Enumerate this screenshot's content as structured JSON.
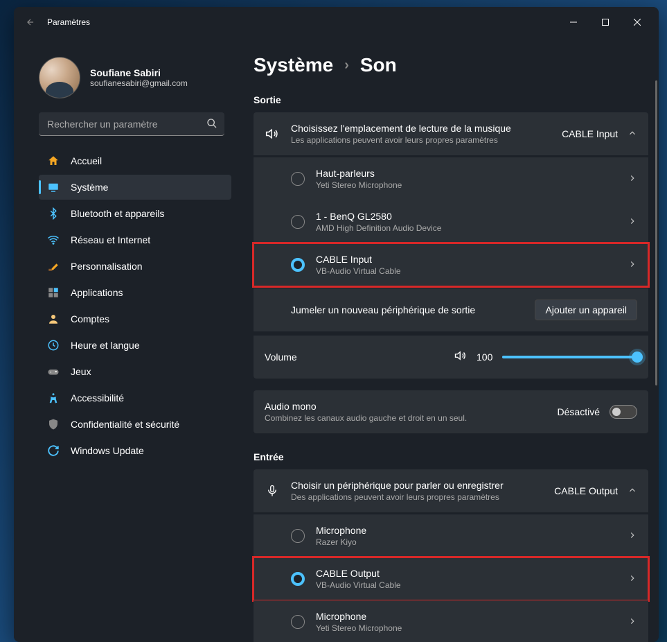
{
  "window": {
    "title": "Paramètres"
  },
  "profile": {
    "name": "Soufiane Sabiri",
    "email": "soufianesabiri@gmail.com"
  },
  "search": {
    "placeholder": "Rechercher un paramètre"
  },
  "nav": [
    {
      "label": "Accueil",
      "icon": "home"
    },
    {
      "label": "Système",
      "icon": "system",
      "active": true
    },
    {
      "label": "Bluetooth et appareils",
      "icon": "bluetooth"
    },
    {
      "label": "Réseau et Internet",
      "icon": "wifi"
    },
    {
      "label": "Personnalisation",
      "icon": "brush"
    },
    {
      "label": "Applications",
      "icon": "apps"
    },
    {
      "label": "Comptes",
      "icon": "person"
    },
    {
      "label": "Heure et langue",
      "icon": "time"
    },
    {
      "label": "Jeux",
      "icon": "gamepad"
    },
    {
      "label": "Accessibilité",
      "icon": "accessibility"
    },
    {
      "label": "Confidentialité et sécurité",
      "icon": "shield"
    },
    {
      "label": "Windows Update",
      "icon": "update"
    }
  ],
  "breadcrumb": {
    "parent": "Système",
    "current": "Son"
  },
  "output": {
    "section": "Sortie",
    "header": {
      "title": "Choisissez l'emplacement de lecture de la musique",
      "sub": "Les applications peuvent avoir leurs propres paramètres",
      "value": "CABLE Input"
    },
    "devices": [
      {
        "name": "Haut-parleurs",
        "sub": "Yeti Stereo Microphone",
        "selected": false
      },
      {
        "name": "1 - BenQ GL2580",
        "sub": "AMD High Definition Audio Device",
        "selected": false
      },
      {
        "name": "CABLE Input",
        "sub": "VB-Audio Virtual Cable",
        "selected": true,
        "highlight": true
      }
    ],
    "pair": {
      "label": "Jumeler un nouveau périphérique de sortie",
      "button": "Ajouter un appareil"
    },
    "volume": {
      "label": "Volume",
      "value": "100"
    },
    "mono": {
      "title": "Audio mono",
      "sub": "Combinez les canaux audio gauche et droit en un seul.",
      "state": "Désactivé"
    }
  },
  "input": {
    "section": "Entrée",
    "header": {
      "title": "Choisir un périphérique pour parler ou enregistrer",
      "sub": "Des applications peuvent avoir leurs propres paramètres",
      "value": "CABLE Output"
    },
    "devices": [
      {
        "name": "Microphone",
        "sub": "Razer Kiyo",
        "selected": false
      },
      {
        "name": "CABLE Output",
        "sub": "VB-Audio Virtual Cable",
        "selected": true,
        "highlight": true
      },
      {
        "name": "Microphone",
        "sub": "Yeti Stereo Microphone",
        "selected": false
      }
    ]
  }
}
